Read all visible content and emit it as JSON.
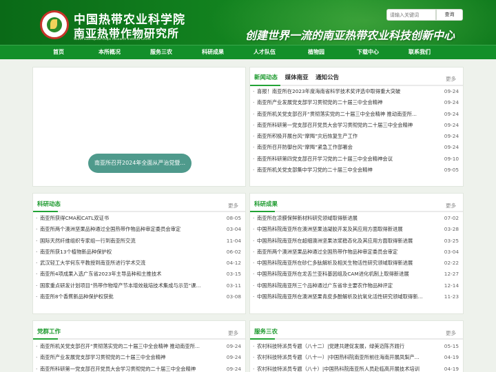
{
  "header": {
    "title_cn_line1": "中国热带农业科学院",
    "title_cn_line2": "南亚热带作物研究所",
    "title_en": "South Subtropical Crops Research Institute CATAS",
    "slogan": "创建世界一流的南亚热带农业科技创新中心",
    "search": {
      "placeholder": "请输入关键词",
      "button_label": "查询"
    }
  },
  "nav": {
    "items": [
      "首页",
      "本所概况",
      "服务三农",
      "科研成果",
      "人才队伍",
      "植物园",
      "下载中心",
      "联系我们"
    ]
  },
  "slider": {
    "caption": "南亚所召开2024年全面从严治党暨..."
  },
  "news": {
    "tabs": [
      "新闻动态",
      "媒体南亚",
      "通知公告"
    ],
    "more": "更多",
    "items": [
      {
        "title": "喜报！南亚所在2023年度海南省科学技术奖评选中取得重大突破",
        "date": "09-24"
      },
      {
        "title": "南亚所产业发展党支部学习贯彻党的二十届三中全会精神",
        "date": "09-24"
      },
      {
        "title": "南亚所机关党支部召开“贯彻落实党的二十届三中全会精神 推动南亚所...",
        "date": "09-24"
      },
      {
        "title": "南亚所科研第一党支部召开党员大会学习贯彻党的二十届三中全会精神",
        "date": "09-24"
      },
      {
        "title": "南亚所积极开展台风“摩羯”灾后恢复生产工作",
        "date": "09-24"
      },
      {
        "title": "南亚所召开防御台风“摩羯”紧急工作部署会",
        "date": "09-24"
      },
      {
        "title": "南亚所科研第四党支部召开学习党的二十届三中全会精神会议",
        "date": "09-10"
      },
      {
        "title": "南亚所机关党支部集中学习党的二十届三中全会精神",
        "date": "09-05"
      }
    ]
  },
  "research_news": {
    "title": "科研动态",
    "more": "更多",
    "items": [
      {
        "title": "南亚所获得CMA和CATL双证书",
        "date": "08-05"
      },
      {
        "title": "南亚所两个澳洲坚果品种通过全国热带作物品种审定委员会审定",
        "date": "03-04"
      },
      {
        "title": "国际天然纤维组织专家组一行到南亚所交流",
        "date": "11-04"
      },
      {
        "title": "南亚所获13个植物新品种保护权",
        "date": "06-02"
      },
      {
        "title": "武汉轻工大学何东平教授到南亚所进行学术交流",
        "date": "04-12"
      },
      {
        "title": "南亚所4项成果入选广东省2023年主导品种和主推技术",
        "date": "03-15"
      },
      {
        "title": "国家重点研发计划项目“热带作物增产节本增效栽培技术集成与示范”课...",
        "date": "03-11"
      },
      {
        "title": "南亚所8个香蕉新品种保护权获批",
        "date": "03-08"
      }
    ]
  },
  "research_results": {
    "title": "科研成果",
    "more": "更多",
    "items": [
      {
        "title": "南亚所在凉膜保鲜新材料研究领域取得新进展",
        "date": "07-02"
      },
      {
        "title": "中国热科院南亚所在澳洲坚果油凝胶开发及其应用方面取得新进展",
        "date": "03-28"
      },
      {
        "title": "中国热科院南亚所在超细澳洲坚果浓浆稳态化及其应用方面取得新进展",
        "date": "03-25"
      },
      {
        "title": "南亚所两个澳洲坚果品种通过全国热带作物品种审定委员会审定",
        "date": "03-04"
      },
      {
        "title": "中国热科院南亚所在砂仁多肽解析及相关生物活性研究领域取得新进展",
        "date": "02-22"
      },
      {
        "title": "中国热科院南亚所在龙舌兰亚科基因组及CAM进化机制上取得新进展",
        "date": "12-27"
      },
      {
        "title": "中国热科院南亚所三个品种通过广东省非主要农作物品种评定",
        "date": "12-14"
      },
      {
        "title": "中国热科院南亚所在澳洲坚果青皮多酚解析及抗氧化活性研究领域取得新进展",
        "date": "11-23"
      }
    ]
  },
  "party_work": {
    "title": "党群工作",
    "more": "更多",
    "items": [
      {
        "title": "南亚所机关党支部召开“贯彻落实党的二十届三中全会精神 推动南亚所...",
        "date": "09-24"
      },
      {
        "title": "南亚所产业发展党支部学习贯彻党的二十届三中全会精神",
        "date": "09-24"
      },
      {
        "title": "南亚所科研第一党支部召开党员大会学习贯彻党的二十届三中全会精神",
        "date": "09-24"
      }
    ]
  },
  "rural_service": {
    "title": "服务三农",
    "more": "更多",
    "items": [
      {
        "title": "农村科技特派员专题（八十二）|党建共建促发展，绿美迈陈齐践行",
        "date": "05-15"
      },
      {
        "title": "农村科技特派员专题（八十一）|中国热科院南亚所前往海南开展凤梨产...",
        "date": "04-19"
      },
      {
        "title": "农村科技特派员专题（八十）|中国热科院南亚所人员赴临高开展技术培训",
        "date": "04-19"
      }
    ]
  },
  "colors": {
    "header_green": "#0f7a1f",
    "nav_green": "#138f2a",
    "accent_green": "#21a335",
    "page_bg": "#eef2ec"
  }
}
